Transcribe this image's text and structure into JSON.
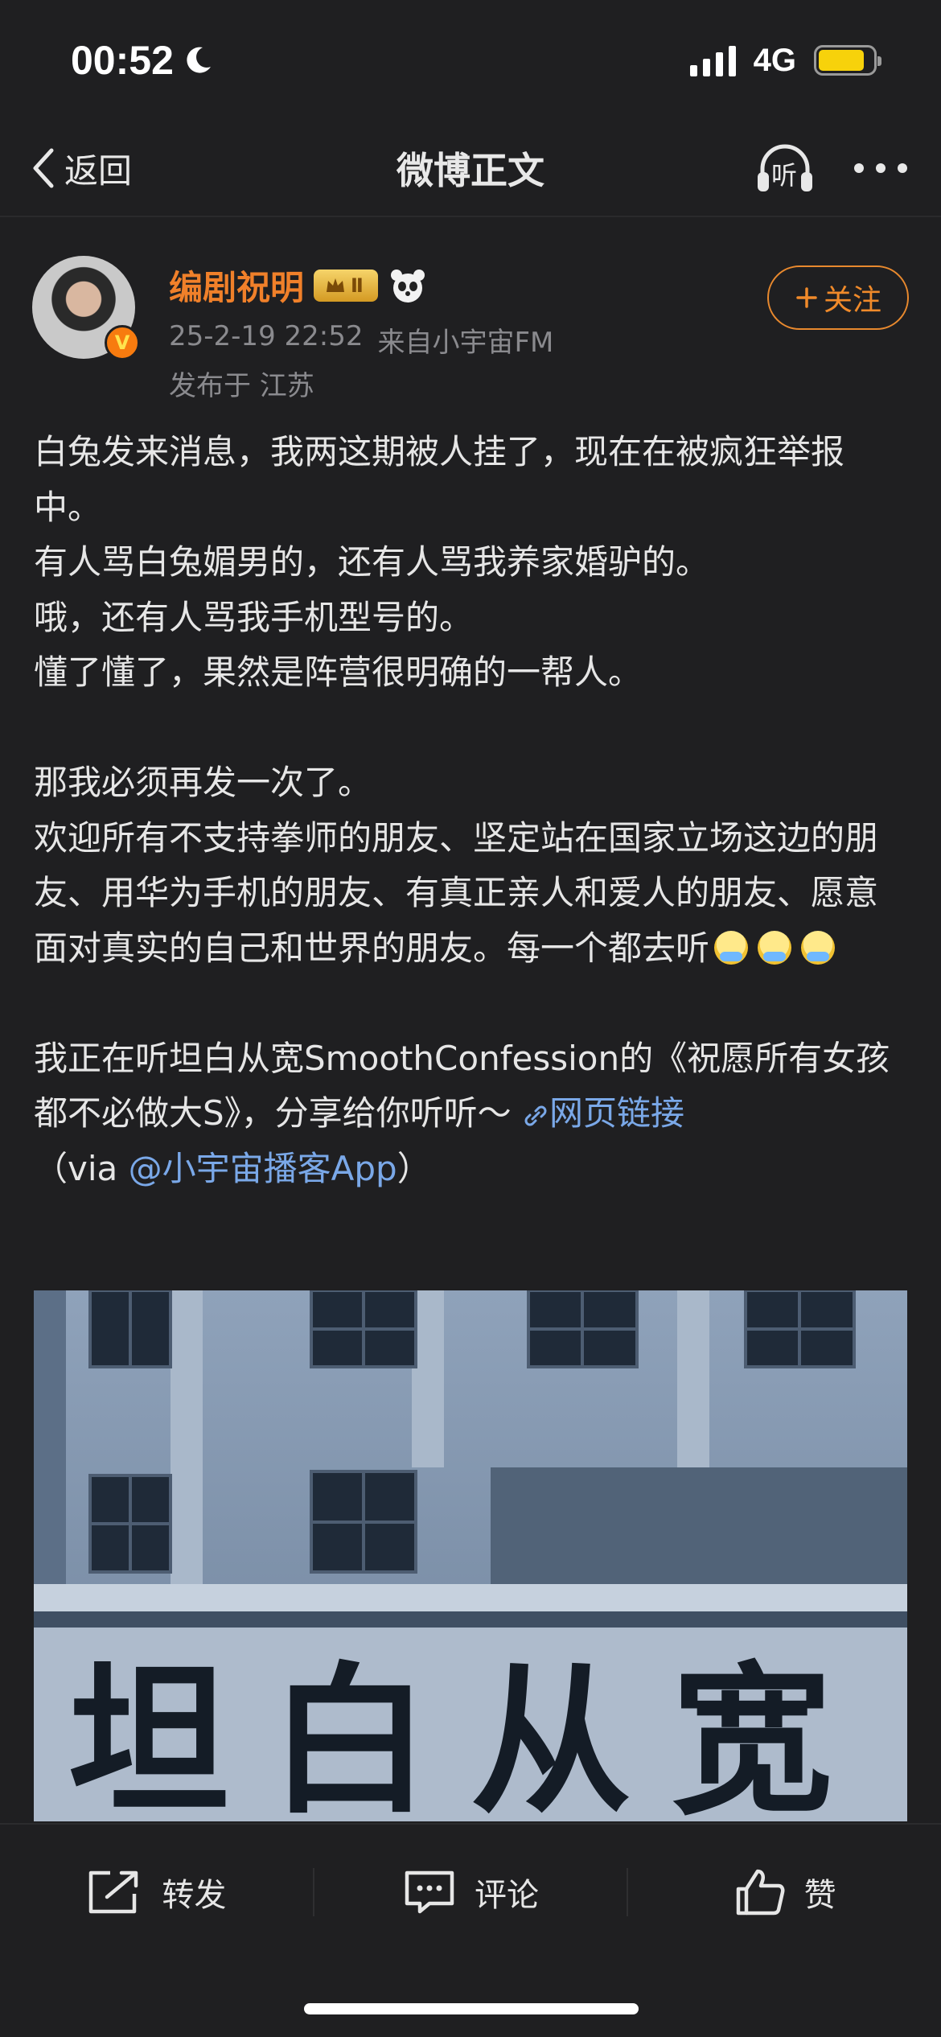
{
  "status_bar": {
    "time": "00:52",
    "network": "4G",
    "battery_fill": 0.85
  },
  "nav": {
    "back_label": "返回",
    "title": "微博正文",
    "listen_label": "听"
  },
  "author": {
    "name": "编剧祝明",
    "level": "Ⅱ",
    "verified_mark": "V",
    "timestamp": "25-2-19 22:52",
    "source": "来自小宇宙FM",
    "location": "发布于 江苏",
    "follow_label": "关注"
  },
  "post": {
    "p1": "白兔发来消息，我两这期被人挂了，现在在被疯狂举报中。\n有人骂白兔媚男的，还有人骂我养家婚驴的。\n哦，还有人骂我手机型号的。\n懂了懂了，果然是阵营很明确的一帮人。",
    "p2": "那我必须再发一次了。\n欢迎所有不支持拳师的朋友、坚定站在国家立场这边的朋友、用华为手机的朋友、有真正亲人和爱人的朋友、愿意面对真实的自己和世界的朋友。每一个都去听",
    "p3_before": "我正在听坦白从宽SmoothConfession的《祝愿所有女孩都不必做大S》，分享给你听听～",
    "link_label": "网页链接",
    "via_open": "（via ",
    "via_link": "@小宇宙播客App",
    "via_close": "）"
  },
  "image": {
    "sign_text": "坦白从宽"
  },
  "actions": {
    "repost": "转发",
    "comment": "评论",
    "like": "赞"
  }
}
